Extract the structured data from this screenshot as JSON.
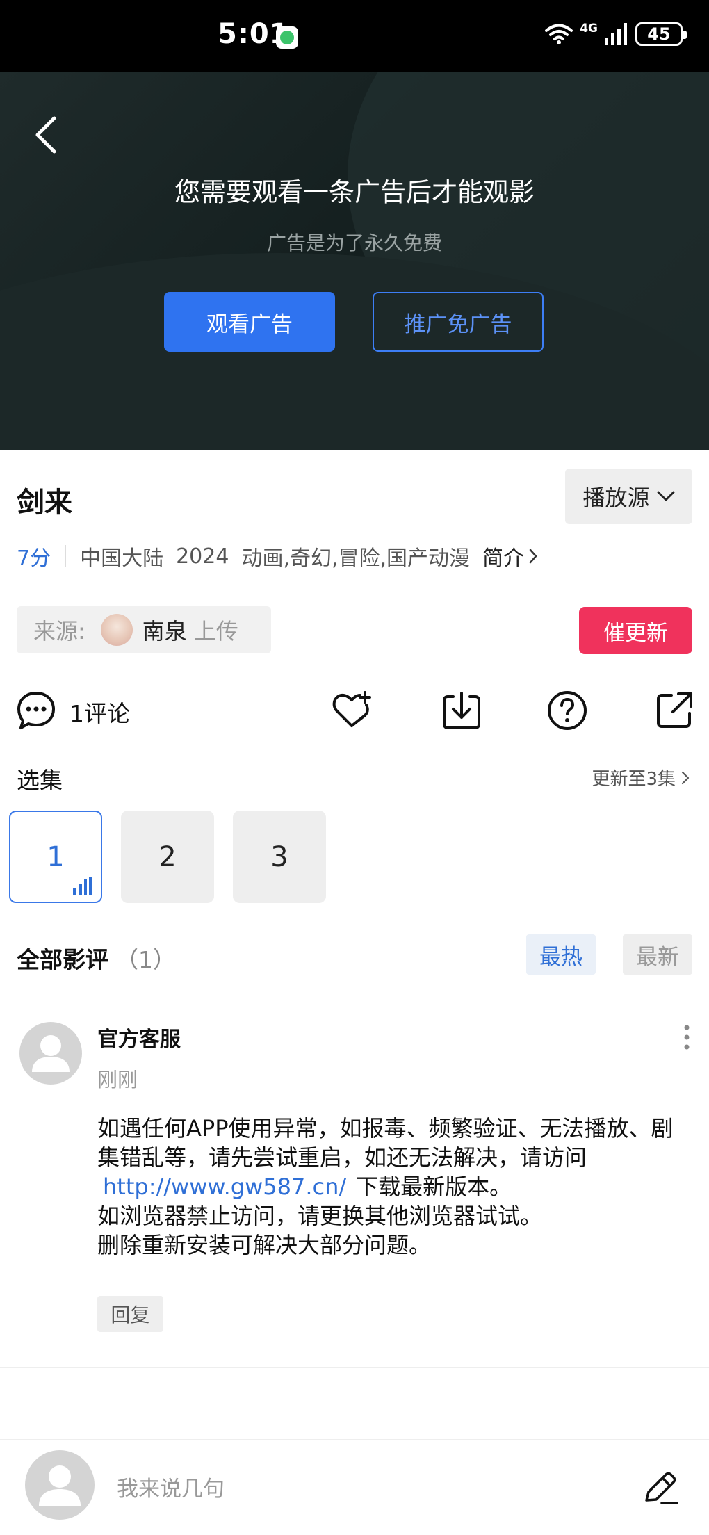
{
  "status_bar": {
    "time": "5:01",
    "network": "4G",
    "battery": "45"
  },
  "ad": {
    "title": "您需要观看一条广告后才能观影",
    "subtitle": "广告是为了永久免费",
    "watch_button": "观看广告",
    "promo_button": "推广免广告"
  },
  "show": {
    "title": "剑来",
    "source_button": "播放源",
    "rating": "7分",
    "region": "中国大陆",
    "year": "2024",
    "genres": "动画,奇幻,冒险,国产动漫",
    "intro_link": "简介"
  },
  "uploader": {
    "label": "来源:",
    "name": "南泉",
    "suffix": "上传",
    "update_button": "催更新"
  },
  "actions": {
    "comment_count": "1评论",
    "icons": [
      "comment-icon",
      "favorite-add-icon",
      "download-icon",
      "help-icon",
      "share-icon"
    ]
  },
  "episodes": {
    "label": "选集",
    "update_status": "更新至3集",
    "items": [
      {
        "label": "1",
        "active": true
      },
      {
        "label": "2",
        "active": false
      },
      {
        "label": "3",
        "active": false
      }
    ]
  },
  "reviews": {
    "title": "全部影评",
    "count": "（1）",
    "sort_hot": "最热",
    "sort_new": "最新",
    "items": [
      {
        "author": "官方客服",
        "time": "刚刚",
        "body_line1": "如遇任何APP使用异常，如报毒、频繁验证、无法播放、剧集错乱等，请先尝试重启，如还无法解决，请访问",
        "link": "http://www.gw587.cn/",
        "body_after_link": "下载最新版本。",
        "body_line3": "如浏览器禁止访问，请更换其他浏览器试试。",
        "body_line4": "删除重新安装可解决大部分问题。",
        "reply_button": "回复"
      }
    ]
  },
  "bottom_bar": {
    "input_placeholder": "我来说几句"
  },
  "colors": {
    "accent": "#2f73f0",
    "hot": "#f0325c",
    "rating": "#2f6fd6"
  }
}
